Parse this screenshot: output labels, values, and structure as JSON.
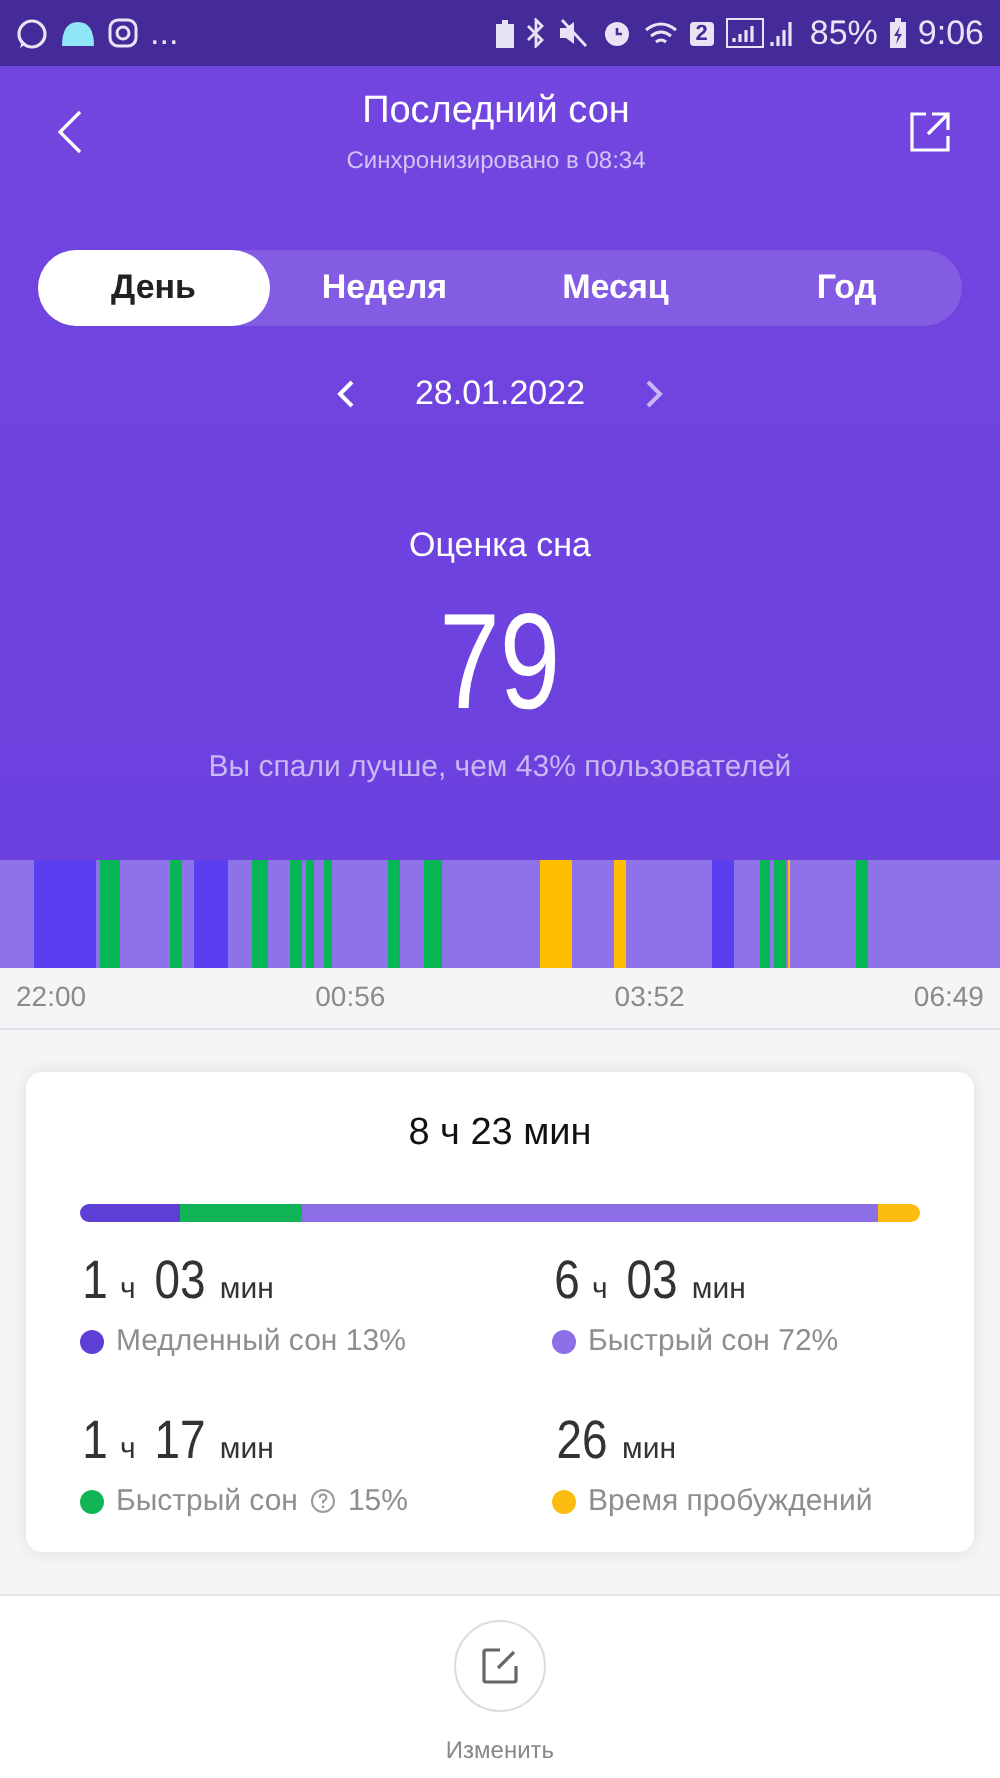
{
  "status_bar": {
    "more": "...",
    "sim_badge": "2",
    "battery": "85%",
    "time": "9:06"
  },
  "header": {
    "title": "Последний сон",
    "subtitle": "Синхронизировано в 08:34"
  },
  "tabs": [
    {
      "label": "День",
      "selected": true
    },
    {
      "label": "Неделя",
      "selected": false
    },
    {
      "label": "Месяц",
      "selected": false
    },
    {
      "label": "Год",
      "selected": false
    }
  ],
  "date": "28.01.2022",
  "score": {
    "label": "Оценка сна",
    "value": "79",
    "caption": "Вы спали лучше, чем 43% пользователей"
  },
  "timeline": {
    "times": [
      "22:00",
      "00:56",
      "03:52",
      "06:49"
    ]
  },
  "summary": {
    "total": "8 ч 23 мин",
    "stages": [
      {
        "duration": [
          {
            "num": "1",
            "unit": "ч"
          },
          {
            "num": "03",
            "unit": "мин"
          }
        ],
        "label": "Медленный сон 13%",
        "help": false,
        "color": "#5e3fd6"
      },
      {
        "duration": [
          {
            "num": "6",
            "unit": "ч"
          },
          {
            "num": "03",
            "unit": "мин"
          }
        ],
        "label": "Быстрый сон 72%",
        "help": false,
        "color": "#8c6ee6"
      },
      {
        "duration": [
          {
            "num": "1",
            "unit": "ч"
          },
          {
            "num": "17",
            "unit": "мин"
          }
        ],
        "label": "Быстрый сон",
        "help": true,
        "percent": "15%",
        "color": "#12b556"
      },
      {
        "duration": [
          {
            "num": "26",
            "unit": "мин"
          }
        ],
        "label": "Время пробуждений",
        "help": false,
        "color": "#fdbd10"
      }
    ]
  },
  "bottom": {
    "edit_label": "Изменить"
  }
}
